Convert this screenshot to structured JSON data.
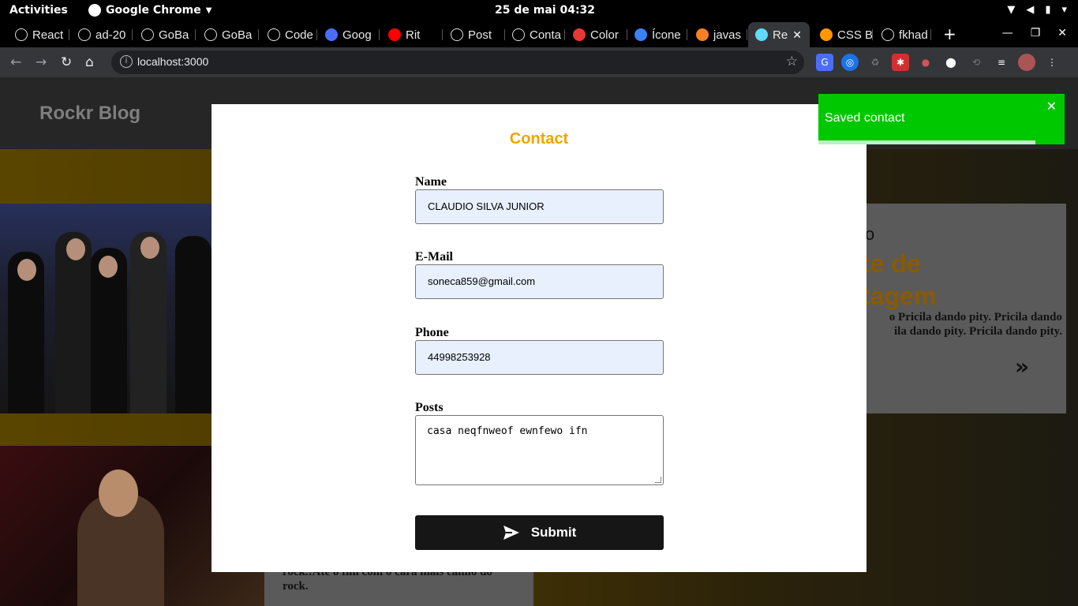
{
  "system": {
    "activities": "Activities",
    "app_name": "Google Chrome",
    "clock": "25 de mai  04:32"
  },
  "browser": {
    "tabs": [
      {
        "label": "React",
        "icon": "github-icon",
        "color": "#ffffff"
      },
      {
        "label": "ad-20",
        "icon": "github-icon",
        "color": "#ffffff"
      },
      {
        "label": "GoBa",
        "icon": "github-icon",
        "color": "#ffffff"
      },
      {
        "label": "GoBa",
        "icon": "github-icon",
        "color": "#ffffff"
      },
      {
        "label": "Code",
        "icon": "github-icon",
        "color": "#ffffff"
      },
      {
        "label": "Goog",
        "icon": "google-translate-icon",
        "color": "#4a6ef5"
      },
      {
        "label": "Rit",
        "icon": "youtube-icon",
        "color": "#ff0000"
      },
      {
        "label": "Post",
        "icon": "globe-icon",
        "color": "#ffffff"
      },
      {
        "label": "Conta",
        "icon": "globe-icon",
        "color": "#ffffff"
      },
      {
        "label": "Color",
        "icon": "material-icon",
        "color": "#e53935"
      },
      {
        "label": "Ícone",
        "icon": "vscode-icon",
        "color": "#3b82f6"
      },
      {
        "label": "javas",
        "icon": "stackoverflow-icon",
        "color": "#f48024"
      },
      {
        "label": "Re",
        "icon": "react-icon",
        "color": "#61dafb"
      },
      {
        "label": "CSS B",
        "icon": "css-icon",
        "color": "#ff9800"
      },
      {
        "label": "fkhad",
        "icon": "github-icon",
        "color": "#ffffff"
      }
    ],
    "active_tab": 12,
    "url": "localhost:3000"
  },
  "page": {
    "brand": "Rockr Blog",
    "card1": {
      "kicker": "o",
      "title": "te de\ntagem",
      "excerpt": "o Pricila dando pity. Pricila dando\nila dando pity. Pricila dando pity.",
      "arrow": "»"
    },
    "card2": {
      "excerpt": "rock.!Ate o fim com o cara mais calmo do\nrock."
    }
  },
  "modal": {
    "title": "Contact",
    "fields": {
      "name_label": "Name",
      "name_value": "CLAUDIO SILVA JUNIOR",
      "email_label": "E-Mail",
      "email_value": "soneca859@gmail.com",
      "phone_label": "Phone",
      "phone_value": "44998253928",
      "posts_label": "Posts",
      "posts_value": "casa neqfnweof ewnfewo ifn"
    },
    "submit_label": "Submit"
  },
  "toast": {
    "message": "Saved contact",
    "progress": 0.88,
    "color": "#00c800"
  }
}
